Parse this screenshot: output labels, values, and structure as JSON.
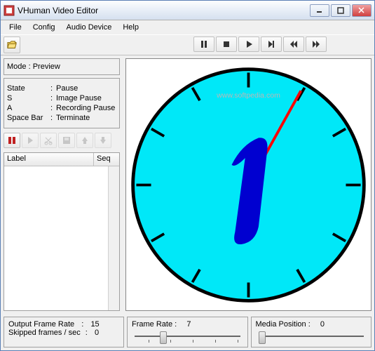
{
  "window": {
    "title": "VHuman Video Editor"
  },
  "menu": {
    "file": "File",
    "config": "Config",
    "audio_device": "Audio Device",
    "help": "Help"
  },
  "mode_box": {
    "label": "Mode :",
    "value": "Preview"
  },
  "shortcuts": {
    "state_key": "State",
    "state_val": "Pause",
    "s_key": "S",
    "s_val": "Image Pause",
    "a_key": "A",
    "a_val": "Recording Pause",
    "space_key": "Space Bar",
    "space_val": "Terminate"
  },
  "list": {
    "col_label": "Label",
    "col_seq": "Seq"
  },
  "stats": {
    "output_frame_rate_label": "Output Frame Rate",
    "output_frame_rate_value": "15",
    "skipped_label": "Skipped frames / sec",
    "skipped_value": "0"
  },
  "sliders": {
    "frame_rate_label": "Frame Rate :",
    "frame_rate_value": "7",
    "media_pos_label": "Media Position :",
    "media_pos_value": "0"
  },
  "watermark": "www.softpedia.com",
  "clock": {
    "number_displayed": "1",
    "hand_angle_deg": 30
  }
}
